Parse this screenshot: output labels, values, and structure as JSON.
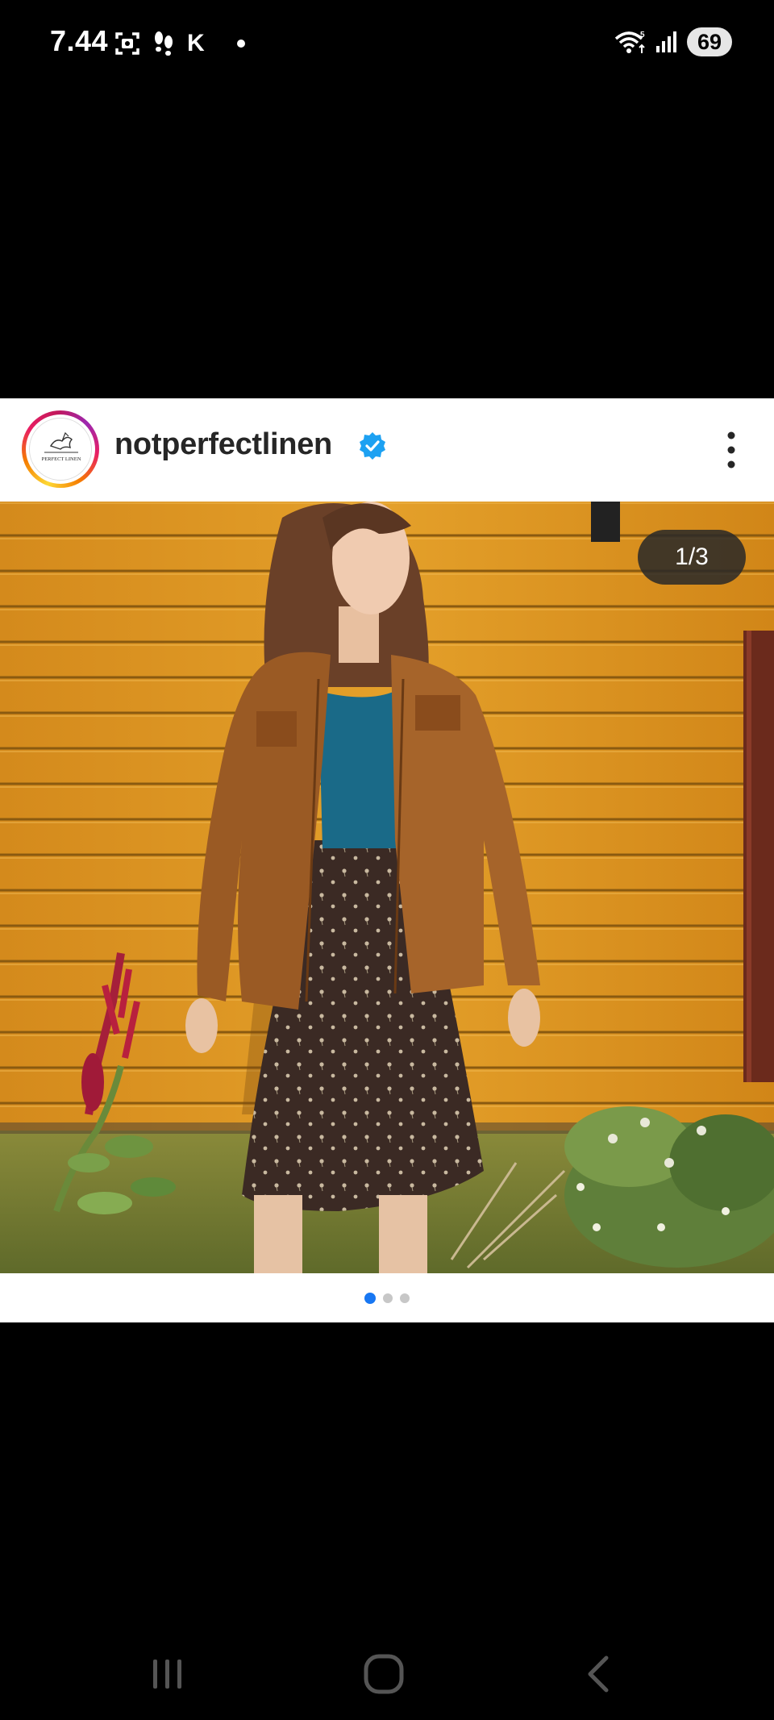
{
  "status_bar": {
    "time": "7.44",
    "carrier_letter": "K",
    "network_label": "5",
    "battery": "69"
  },
  "post": {
    "username": "notperfectlinen",
    "avatar_text": "PERFECT LINEN",
    "verified": true,
    "photo_counter": "1/3",
    "carousel_total": 3,
    "carousel_active": 0,
    "photo_description_icon": "photo-of-woman-in-brown-linen-jacket",
    "colors": {
      "verified_blue": "#1da1f2",
      "dot_active": "#1877f2",
      "wall": "#d4901f"
    }
  },
  "nav_bar": {
    "icons": [
      "recent-apps-icon",
      "home-icon",
      "back-icon"
    ]
  }
}
